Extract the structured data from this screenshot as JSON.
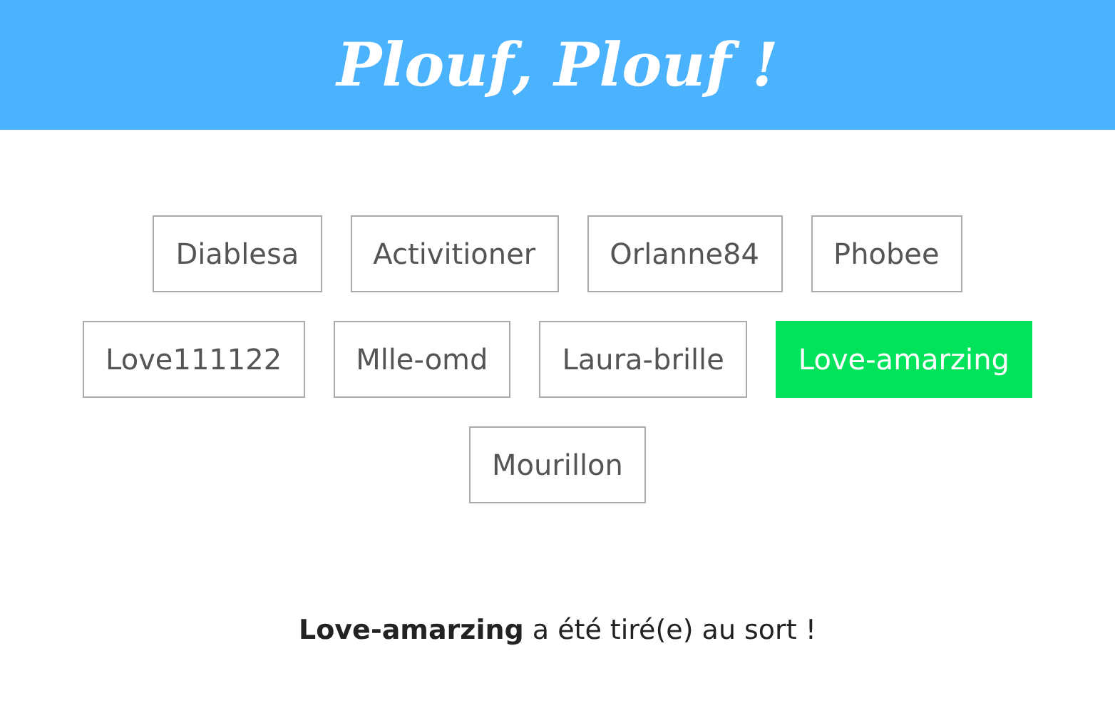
{
  "header": {
    "title": "Plouf, Plouf !"
  },
  "names": [
    {
      "label": "Diablesa",
      "selected": false
    },
    {
      "label": "Activitioner",
      "selected": false
    },
    {
      "label": "Orlanne84",
      "selected": false
    },
    {
      "label": "Phobee",
      "selected": false
    },
    {
      "label": "Love111122",
      "selected": false
    },
    {
      "label": "Mlle-omd",
      "selected": false
    },
    {
      "label": "Laura-brille",
      "selected": false
    },
    {
      "label": "Love-amarzing",
      "selected": true
    },
    {
      "label": "Mourillon",
      "selected": false
    }
  ],
  "result": "**Love-amarzing** a été tiré(e) au sort !"
}
